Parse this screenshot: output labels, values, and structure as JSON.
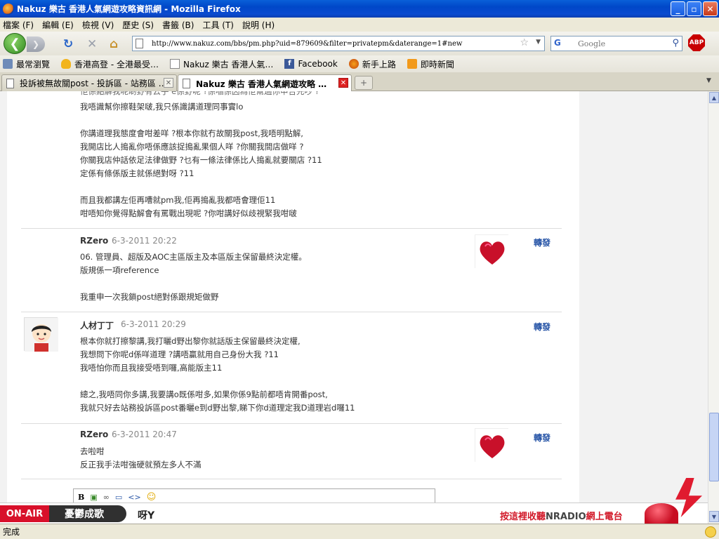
{
  "window": {
    "title": "Nakuz 樂古 香港人氣網遊攻略資訊網 - Mozilla Firefox",
    "min": "_",
    "max": "▫",
    "close": "✕"
  },
  "menu": [
    "檔案 (F)",
    "編輯 (E)",
    "檢視 (V)",
    "歷史 (S)",
    "書籤 (B)",
    "工具 (T)",
    "說明 (H)"
  ],
  "nav": {
    "url": "http://www.nakuz.com/bbs/pm.php?uid=879609&filter=privatepm&daterange=1#new",
    "search_placeholder": "Google",
    "abp": "ABP"
  },
  "bookmarks": [
    {
      "label": "最常瀏覽",
      "icon": "bm-frequent"
    },
    {
      "label": "香港高登 - 全港最受…",
      "icon": "bm-hand"
    },
    {
      "label": "Nakuz 樂古 香港人氣…",
      "icon": "bm-page"
    },
    {
      "label": "Facebook",
      "icon": "bm-fb"
    },
    {
      "label": "新手上路",
      "icon": "bm-ff"
    },
    {
      "label": "即時新聞",
      "icon": "bm-rss"
    }
  ],
  "tabs": [
    {
      "label": "投訴被無故關post - 投訴區 - 站務區 …",
      "active": false
    },
    {
      "label": "Nakuz 樂古 香港人氣網遊攻略 …",
      "active": true
    }
  ],
  "content": {
    "cut_line": "佢係點解我呢啲野有云乎 e係野呢 ?係嗰係因為佢幫過你申告先吵 ?",
    "first_block": [
      "我唔識幫你擦鞋架啵,我只係識講道理同事實lo",
      "",
      "你講道理我態度會咁差咩 ?根本你就冇故關我post,我唔明點解,",
      "我開店比人搗亂你唔係應該捉搗亂果個人咩 ?你關我間店做咩 ?",
      "你關我店仲話依足法律做野 ?乜有一條法律係比人搗亂就要關店 ?11",
      "定係有條係版主就係絕對呀 ?11",
      "",
      "而且我都講左佢再嘈就pm我,佢再搗亂我都唔會理佢11",
      "咁唔知你覺得點解會有罵戰出現呢 ?你咁講好似歧視緊我咁啵"
    ],
    "forward_label": "轉發",
    "posts": [
      {
        "author": "RZero",
        "date": "6-3-2011 20:22",
        "avatar": "heart",
        "lines": [
          "06. 管理員、超版及AOC主區版主及本區版主保留最終決定權。",
          "版規係一項reference",
          "",
          "我重申一次我鎖post絕對係跟規矩做野"
        ]
      },
      {
        "author": "人材丁丁",
        "date": "6-3-2011 20:29",
        "avatar": "person",
        "lines": [
          "根本你就打擦黎講,我打曬d野出黎你就話版主保留最終決定權,",
          "我想問下你呢d係咩道理 ?講唔贏就用自己身份大我 ?11",
          "我唔怕你而且我接受唔到囉,高能版主11",
          "",
          "總之,我唔同你多講,我要講o既係咁多,如果你係9點前都唔肯開番post,",
          "我就只好去站務投訴區post番曬e到d野出黎,睇下你d道理定我D道理岩d囉11"
        ]
      },
      {
        "author": "RZero",
        "date": "6-3-2011 20:47",
        "avatar": "heart",
        "lines": [
          "去啦咁",
          "反正我手法咁強硬就預左多人不滿"
        ]
      }
    ],
    "editor_tools": [
      "B",
      "▣",
      "∞",
      "▭",
      "<>",
      "☺"
    ]
  },
  "radio": {
    "onair": "ON-AIR",
    "program": "憂鬱成歌",
    "song": "呀Y",
    "listen_prefix": "按這裡收聽",
    "listen_brand": "NRADIO",
    "listen_suffix": "網上電台"
  },
  "status": {
    "text": "完成"
  },
  "colors": {
    "titlebar": "#0a5fd8",
    "link": "#2a57a8",
    "onair": "#d8102a"
  }
}
